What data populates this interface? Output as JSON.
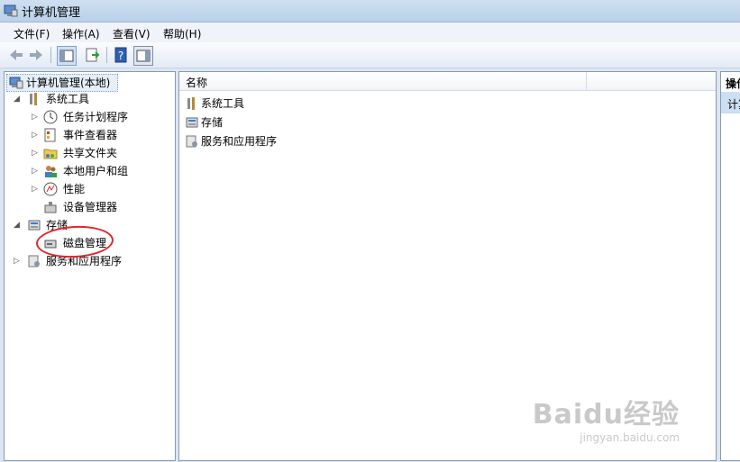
{
  "window": {
    "title": "计算机管理"
  },
  "menu": [
    "文件(F)",
    "操作(A)",
    "查看(V)",
    "帮助(H)"
  ],
  "tree": {
    "root": "计算机管理(本地)",
    "system_tools": "系统工具",
    "task_scheduler": "任务计划程序",
    "event_viewer": "事件查看器",
    "shared_folders": "共享文件夹",
    "local_users": "本地用户和组",
    "performance": "性能",
    "device_manager": "设备管理器",
    "storage": "存储",
    "disk_management": "磁盘管理",
    "services_apps": "服务和应用程序"
  },
  "list": {
    "column_name": "名称",
    "items": [
      "系统工具",
      "存储",
      "服务和应用程序"
    ]
  },
  "actions": {
    "header": "操作",
    "item": "计算机管理"
  },
  "watermark": {
    "brand": "Baidu经验",
    "url": "jingyan.baidu.com"
  }
}
